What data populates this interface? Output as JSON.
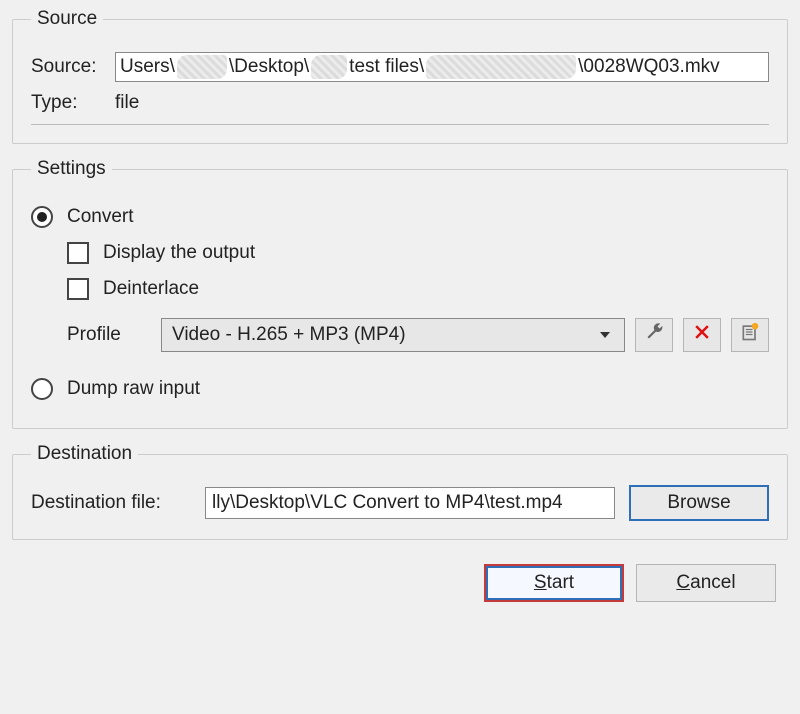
{
  "source": {
    "legend": "Source",
    "source_label": "Source:",
    "path_prefix": "Users\\",
    "path_mid1": "\\Desktop\\",
    "path_mid2": "test files\\",
    "path_suffix": "\\0028WQ03.mkv",
    "type_label": "Type:",
    "type_value": "file"
  },
  "settings": {
    "legend": "Settings",
    "convert_label": "Convert",
    "convert_selected": true,
    "display_output_label": "Display the output",
    "display_output_checked": false,
    "deinterlace_label": "Deinterlace",
    "deinterlace_checked": false,
    "profile_label": "Profile",
    "profile_value": "Video - H.265 + MP3 (MP4)",
    "dump_label": "Dump raw input",
    "dump_selected": false
  },
  "destination": {
    "legend": "Destination",
    "file_label": "Destination file:",
    "file_value": "lly\\Desktop\\VLC Convert to MP4\\test.mp4",
    "browse_label": "Browse"
  },
  "buttons": {
    "start_prefix": "S",
    "start_rest": "tart",
    "cancel_prefix": "C",
    "cancel_rest": "ancel"
  }
}
